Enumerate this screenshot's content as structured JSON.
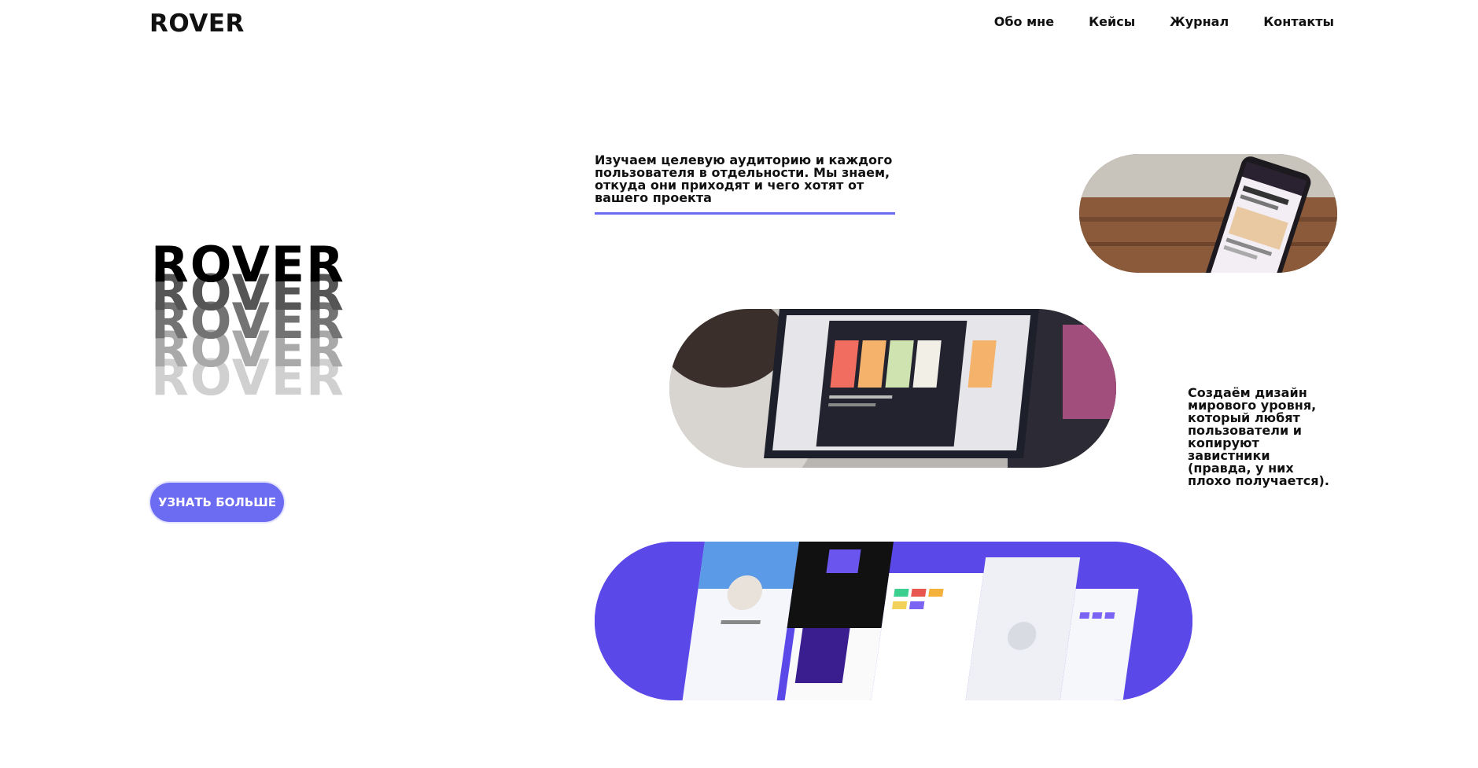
{
  "header": {
    "logo": "ROVER",
    "nav": [
      "Обо мне",
      "Кейсы",
      "Журнал",
      "Контакты"
    ]
  },
  "hero": {
    "word": "ROVER",
    "cta_label": "УЗНАТЬ БОЛЬШЕ"
  },
  "blocks": {
    "text1": "Изучаем целевую аудиторию и каждого пользователя в отдельности. Мы знаем, откуда они приходят и чего хотят от вашего проекта",
    "text2": "Создаём дизайн мирового уровня, который любят пользователи и копируют завистники (правда, у них плохо получается)."
  },
  "colors": {
    "accent": "#6c6cf2",
    "pill_purple": "#5b48e8"
  }
}
